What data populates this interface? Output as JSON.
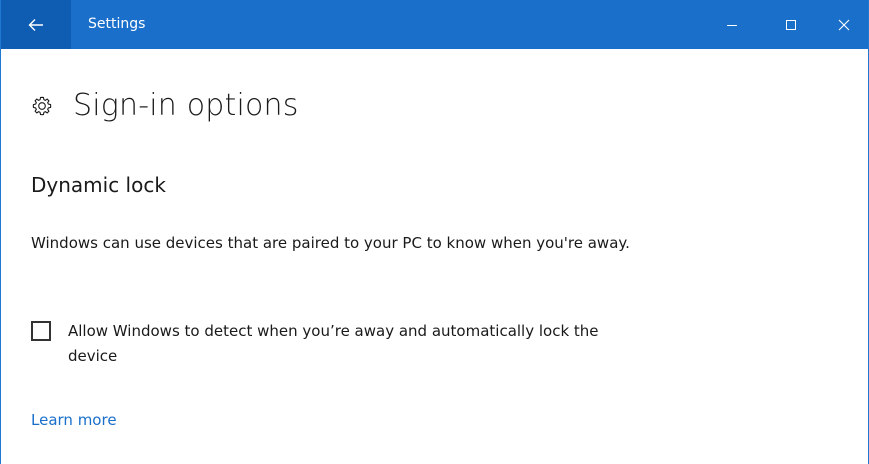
{
  "window": {
    "title": "Settings",
    "accent_color": "#1a6fcb",
    "back_button_color": "#0f5cb3",
    "controls": {
      "back_icon": "back-arrow-icon",
      "minimize_icon": "minimize-icon",
      "maximize_icon": "maximize-icon",
      "close_icon": "close-icon"
    }
  },
  "page": {
    "icon": "gear-icon",
    "title": "Sign-in options"
  },
  "dynamic_lock": {
    "heading": "Dynamic lock",
    "description": "Windows can use devices that are paired to your PC to know when you're away.",
    "checkbox": {
      "label": "Allow Windows to detect when you’re away and automatically lock the device",
      "checked": false
    },
    "link": {
      "label": "Learn more",
      "color": "#1a6fcb"
    }
  }
}
